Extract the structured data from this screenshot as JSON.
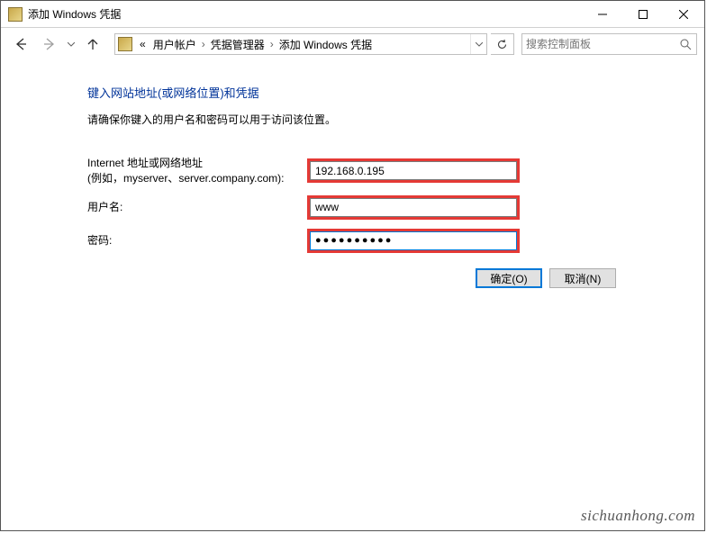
{
  "window": {
    "title": "添加 Windows 凭据"
  },
  "nav": {
    "breadcrumb_prefix": "«",
    "crumbs": [
      "用户帐户",
      "凭据管理器",
      "添加 Windows 凭据"
    ],
    "search_placeholder": "搜索控制面板"
  },
  "page": {
    "heading": "键入网站地址(或网络位置)和凭据",
    "subtext": "请确保你键入的用户名和密码可以用于访问该位置。"
  },
  "form": {
    "address_label_line1": "Internet 地址或网络地址",
    "address_label_line2": "(例如，myserver、server.company.com):",
    "address_value": "192.168.0.195",
    "username_label": "用户名:",
    "username_value": "www",
    "password_label": "密码:",
    "password_value": "●●●●●●●●●●"
  },
  "buttons": {
    "ok": "确定(O)",
    "cancel": "取消(N)"
  },
  "watermark": "sichuanhong.com"
}
